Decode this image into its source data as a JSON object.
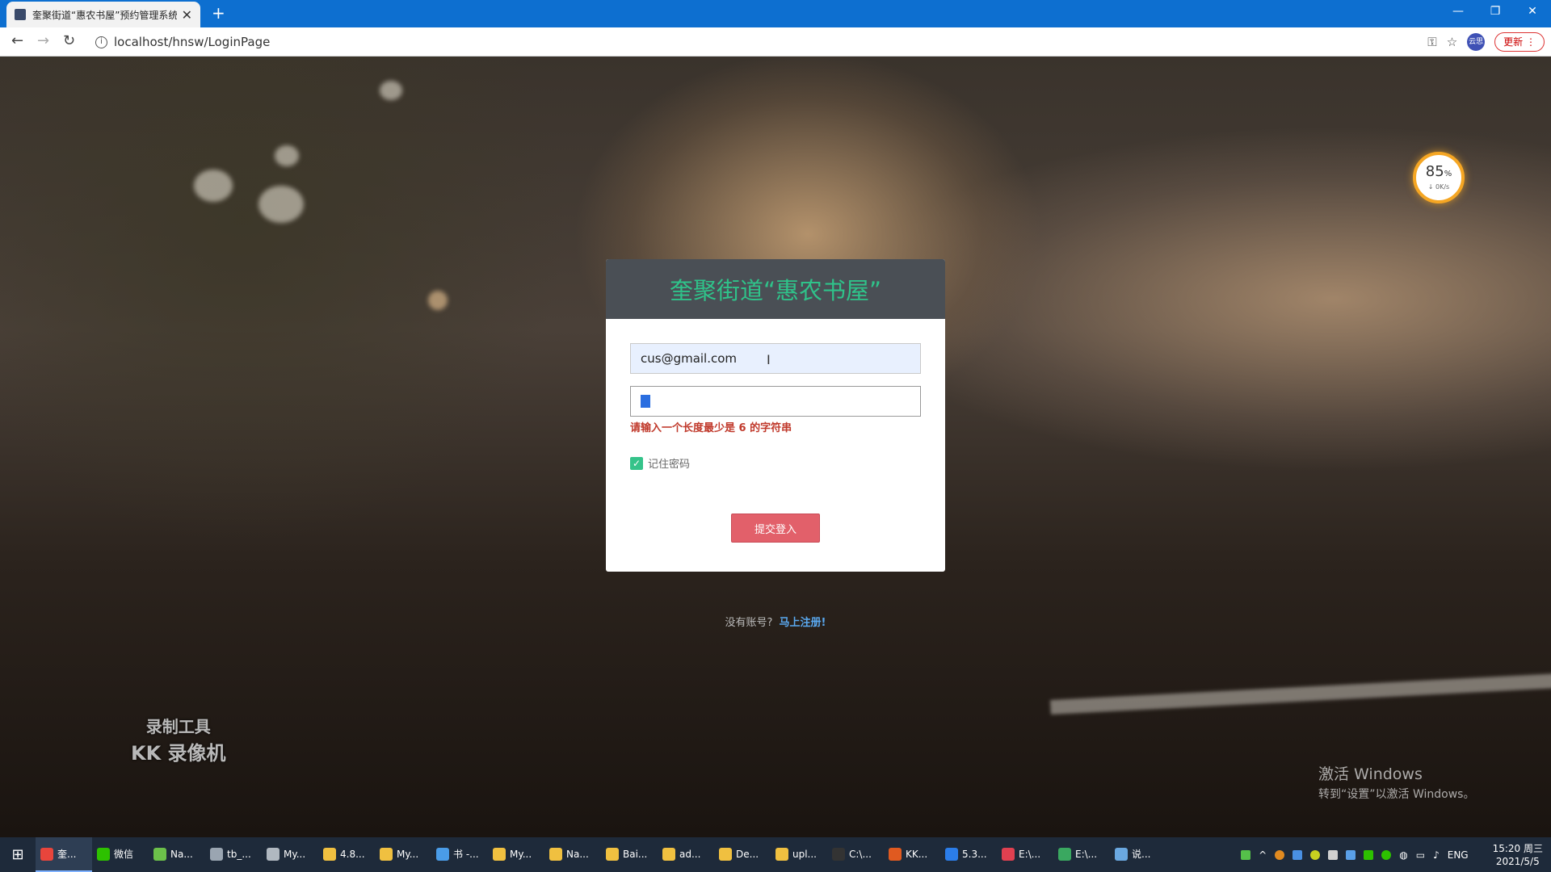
{
  "browser": {
    "tab_title": "奎聚街道“惠农书屋”预约管理系统",
    "new_tab_glyph": "+",
    "url": "localhost/hnsw/LoginPage",
    "update_label": "更新",
    "profile_label": "云思"
  },
  "speed_widget": {
    "percent": "85",
    "percent_unit": "%",
    "rate": "↓ 0K/s"
  },
  "login": {
    "title": "奎聚街道“惠农书屋”",
    "email_value": "cus@gmail.com",
    "error": "请输入一个长度最少是 6 的字符串",
    "remember_label": "记住密码",
    "remember_checked": true,
    "submit_label": "提交登入"
  },
  "register": {
    "prompt": "没有账号?",
    "link": "马上注册!"
  },
  "overlays": {
    "kk_line1": "录制工具",
    "kk_line2": "KK 录像机",
    "activate_line1": "激活 Windows",
    "activate_line2": "转到“设置”以激活 Windows。"
  },
  "taskbar": {
    "items": [
      {
        "label": "奎...",
        "icon": "chrome-icon",
        "color": "#e8453c",
        "active": true
      },
      {
        "label": "微信",
        "icon": "wechat-icon",
        "color": "#2dc100"
      },
      {
        "label": "Na...",
        "icon": "app-icon",
        "color": "#6cc04a"
      },
      {
        "label": "tb_...",
        "icon": "app-icon",
        "color": "#9aa5b1"
      },
      {
        "label": "My...",
        "icon": "pen-icon",
        "color": "#b0b8c0"
      },
      {
        "label": "4.8...",
        "icon": "folder-icon",
        "color": "#f0c040"
      },
      {
        "label": "My...",
        "icon": "folder-icon",
        "color": "#f0c040"
      },
      {
        "label": "书 -...",
        "icon": "app-icon",
        "color": "#4a9ce8"
      },
      {
        "label": "My...",
        "icon": "folder-icon",
        "color": "#f0c040"
      },
      {
        "label": "Na...",
        "icon": "folder-icon",
        "color": "#f0c040"
      },
      {
        "label": "Bai...",
        "icon": "folder-icon",
        "color": "#f0c040"
      },
      {
        "label": "ad...",
        "icon": "folder-icon",
        "color": "#f0c040"
      },
      {
        "label": "De...",
        "icon": "folder-icon",
        "color": "#f0c040"
      },
      {
        "label": "upl...",
        "icon": "folder-icon",
        "color": "#f0c040"
      },
      {
        "label": "C:\\...",
        "icon": "terminal-icon",
        "color": "#333333"
      },
      {
        "label": "KK...",
        "icon": "recorder-icon",
        "color": "#e05a20"
      },
      {
        "label": "5.3...",
        "icon": "vscode-icon",
        "color": "#2b7de9"
      },
      {
        "label": "E:\\...",
        "icon": "app-icon",
        "color": "#e04050"
      },
      {
        "label": "E:\\...",
        "icon": "app-icon",
        "color": "#3aa860"
      },
      {
        "label": "说...",
        "icon": "app-icon",
        "color": "#6aa8e0"
      }
    ],
    "language": "ENG",
    "time": "15:20 周三",
    "date": "2021/5/5"
  }
}
